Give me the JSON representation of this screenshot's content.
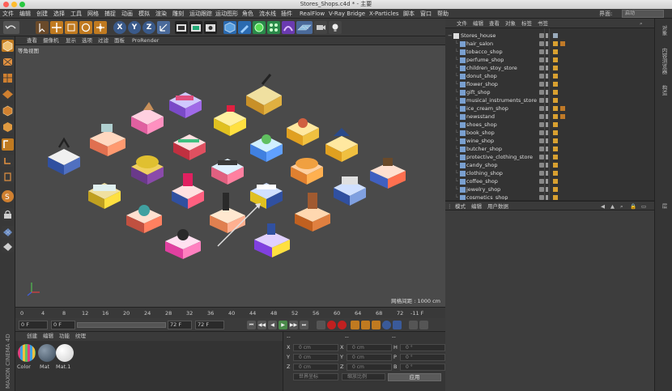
{
  "window": {
    "title": "Stores_Shops.c4d * - 主要",
    "controls": {
      "close": "#fe5f57",
      "minimize": "#febc2e",
      "zoom": "#28c840"
    }
  },
  "menubar": {
    "items": [
      "文件",
      "编辑",
      "创建",
      "选择",
      "工具",
      "网格",
      "捕捉",
      "动画",
      "模拟",
      "渲染",
      "雕刻",
      "运动跟踪",
      "运动图形",
      "角色",
      "流水线",
      "插件",
      "RealFlow",
      "V-Ray Bridge",
      "X-Particles",
      "脚本",
      "窗口",
      "帮助"
    ],
    "layout_label": "界面:",
    "layout_value": "启动"
  },
  "toolbar": {
    "icons": [
      "undo-icon",
      "select-icon",
      "move-icon",
      "scale-icon",
      "rotate-icon",
      "move-tool-icon",
      "x-axis-icon",
      "y-axis-icon",
      "z-axis-icon",
      "coordinate-system-icon",
      "render-view-icon",
      "render-picture-queue-icon",
      "render-settings-icon",
      "cube-icon",
      "pen-icon",
      "subdivision-icon",
      "array-icon",
      "deformer-icon",
      "floor-icon",
      "camera-icon",
      "light-icon"
    ],
    "axis_labels": [
      "X",
      "Y",
      "Z"
    ]
  },
  "viewport": {
    "menu": [
      "查看",
      "摄像机",
      "显示",
      "选项",
      "过滤",
      "面板",
      "ProRender"
    ],
    "label": "等角视图",
    "grid_spacing": "网格间距 : 1000 cm"
  },
  "timeline": {
    "ticks": [
      "0",
      "4",
      "8",
      "12",
      "16",
      "20",
      "24",
      "28",
      "32",
      "36",
      "40",
      "44",
      "48",
      "52",
      "56",
      "60",
      "64",
      "68",
      "72"
    ],
    "current_frame": "-11 F"
  },
  "transport": {
    "start": "0 F",
    "start_field": "0 F",
    "end_field": "72 F",
    "end": "72 F",
    "buttons": [
      "⏮",
      "◀◀",
      "◀",
      "▶",
      "▶▶",
      "⏭"
    ]
  },
  "materials": {
    "menu": [
      "创建",
      "编辑",
      "功能",
      "纹理"
    ],
    "items": [
      {
        "name": "Color",
        "swatch": "#d24a8a"
      },
      {
        "name": "Mat",
        "swatch": "#5a6a7a"
      },
      {
        "name": "Mat.1",
        "swatch": "#ffffff"
      }
    ]
  },
  "coordinates": {
    "header": [
      "--",
      "--",
      "--"
    ],
    "rows": [
      {
        "a": "X",
        "av": "0 cm",
        "b": "X",
        "bv": "0 cm",
        "c": "H",
        "cv": "0 °"
      },
      {
        "a": "Y",
        "av": "0 cm",
        "b": "Y",
        "bv": "0 cm",
        "c": "P",
        "cv": "0 °"
      },
      {
        "a": "Z",
        "av": "0 cm",
        "b": "Z",
        "bv": "0 cm",
        "c": "B",
        "cv": "0 °"
      }
    ],
    "mode_1": "世界坐标",
    "mode_2": "缩放比例",
    "apply": "应用"
  },
  "object_manager": {
    "menu": [
      "文件",
      "编辑",
      "查看",
      "对象",
      "标签",
      "书签"
    ],
    "root": "Stores_house",
    "objects": [
      "hair_salon",
      "tobacco_shop",
      "perfume_shop",
      "children_stoy_store",
      "donut_shop",
      "flower_shop",
      "gift_shop",
      "musical_instruments_store",
      "ice_cream_shop",
      "newsstand",
      "shoes_shop",
      "book_shop",
      "wine_shop",
      "butcher_shop",
      "protective_clothing_store",
      "candy_shop",
      "clothing_shop",
      "coffee_shop",
      "jewelry_shop",
      "cosmetics_shop"
    ],
    "tagged": [
      0,
      8,
      9
    ]
  },
  "attribute_manager": {
    "menu": [
      "模式",
      "编辑",
      "用户数据"
    ]
  },
  "right_tabs": [
    "对象",
    "内容浏览器",
    "构造",
    "层"
  ],
  "brand": "MAXON CINEMA 4D"
}
